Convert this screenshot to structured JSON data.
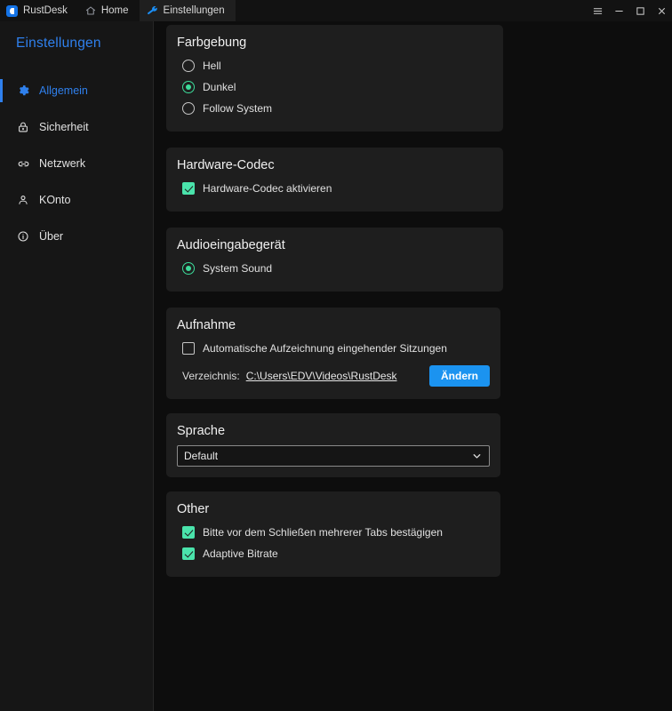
{
  "window": {
    "tabs": [
      {
        "label": "RustDesk",
        "icon": "rustdesk-logo-icon",
        "active": false
      },
      {
        "label": "Home",
        "icon": "home-icon",
        "active": false
      },
      {
        "label": "Einstellungen",
        "icon": "wrench-icon",
        "active": true
      }
    ],
    "controls": [
      {
        "name": "menu-button",
        "icon": "hamburger-icon"
      },
      {
        "name": "minimize-button",
        "icon": "minimize-icon"
      },
      {
        "name": "maximize-button",
        "icon": "maximize-icon"
      },
      {
        "name": "close-button",
        "icon": "close-icon"
      }
    ]
  },
  "sidebar": {
    "title": "Einstellungen",
    "items": [
      {
        "label": "Allgemein",
        "icon": "gear-icon",
        "active": true
      },
      {
        "label": "Sicherheit",
        "icon": "lock-icon",
        "active": false
      },
      {
        "label": "Netzwerk",
        "icon": "link-icon",
        "active": false
      },
      {
        "label": "KOnto",
        "icon": "person-icon",
        "active": false
      },
      {
        "label": "Über",
        "icon": "info-icon",
        "active": false
      }
    ]
  },
  "main": {
    "theme": {
      "title": "Farbgebung",
      "options": [
        {
          "label": "Hell",
          "selected": false
        },
        {
          "label": "Dunkel",
          "selected": true
        },
        {
          "label": "Follow System",
          "selected": false
        }
      ]
    },
    "codec": {
      "title": "Hardware-Codec",
      "option": {
        "label": "Hardware-Codec aktivieren",
        "checked": true
      }
    },
    "audio": {
      "title": "Audioeingabegerät",
      "options": [
        {
          "label": "System Sound",
          "selected": true
        }
      ]
    },
    "recording": {
      "title": "Aufnahme",
      "auto_record": {
        "label": "Automatische Aufzeichnung eingehender Sitzungen",
        "checked": false
      },
      "directory_label": "Verzeichnis:",
      "directory_path": "C:\\Users\\EDV\\Videos\\RustDesk",
      "change_button": "Ändern"
    },
    "language": {
      "title": "Sprache",
      "selected": "Default",
      "options": [
        "Default"
      ]
    },
    "other": {
      "title": "Other",
      "options": [
        {
          "label": "Bitte vor dem Schließen mehrerer Tabs bestägigen",
          "checked": true
        },
        {
          "label": "Adaptive Bitrate",
          "checked": true
        }
      ]
    }
  },
  "colors": {
    "accent_blue": "#2f80ed",
    "button_blue": "#1b93f0",
    "accent_green": "#4ae3ab",
    "page_bg": "#0d0d0d",
    "card_bg": "#1e1e1e",
    "sidebar_bg": "#161616"
  }
}
